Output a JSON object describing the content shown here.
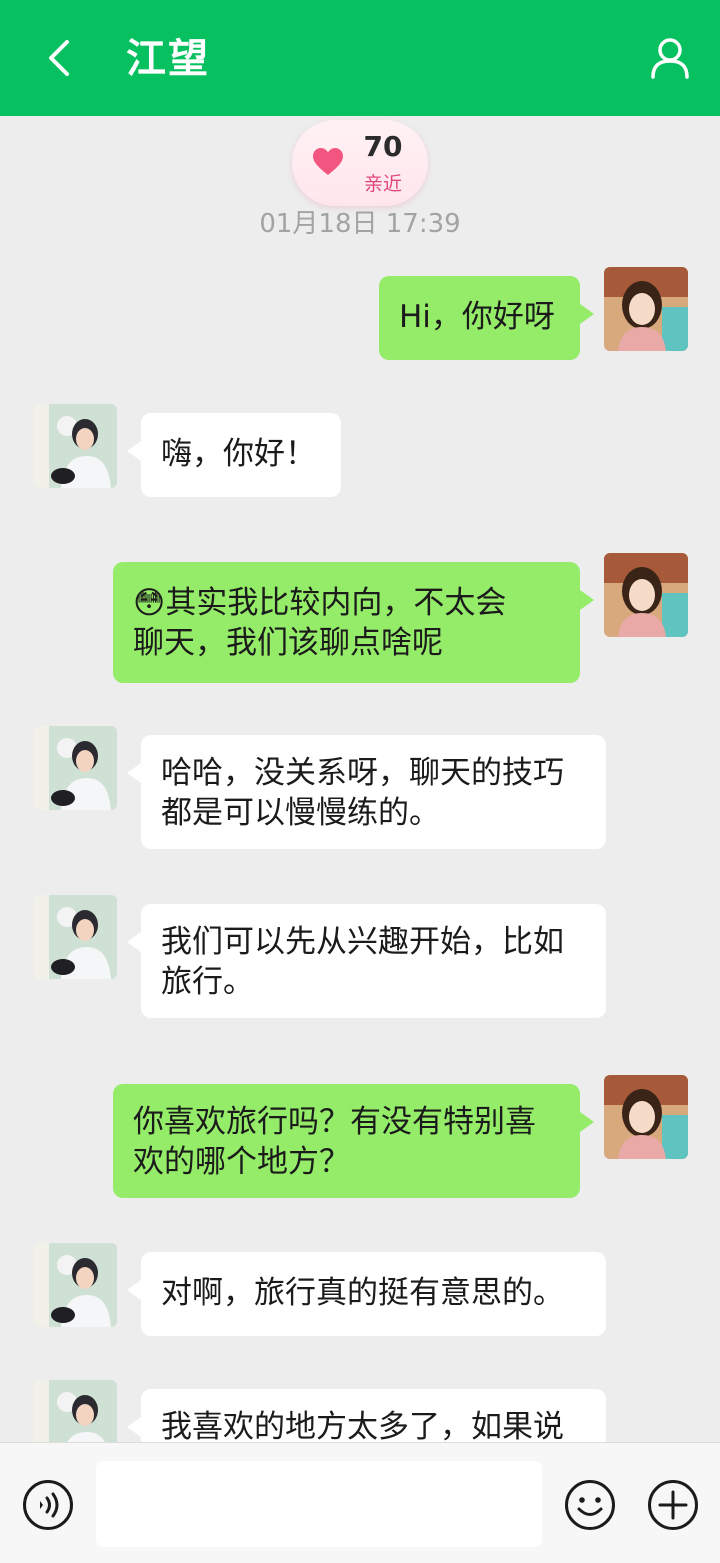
{
  "header": {
    "title": "江望",
    "colors": {
      "bar": "#07c160"
    }
  },
  "intimacy": {
    "score": "70",
    "label": "亲近"
  },
  "timestamp": "01月18日 17:39",
  "messages": [
    {
      "sender": "me",
      "lines": [
        "Hi，你好呀"
      ]
    },
    {
      "sender": "other",
      "lines": [
        "嗨，你好！"
      ]
    },
    {
      "sender": "me",
      "lines": [
        "😳其实我比较内向，不太会",
        "聊天，我们该聊点啥呢"
      ]
    },
    {
      "sender": "other",
      "lines": [
        "哈哈，没关系呀，聊天的技巧",
        "都是可以慢慢练的。"
      ]
    },
    {
      "sender": "other",
      "lines": [
        "我们可以先从兴趣开始，比如",
        "旅行。"
      ]
    },
    {
      "sender": "me",
      "lines": [
        "你喜欢旅行吗？有没有特别喜",
        "欢的哪个地方？"
      ]
    },
    {
      "sender": "other",
      "lines": [
        "对啊，旅行真的挺有意思的。"
      ]
    },
    {
      "sender": "other",
      "lines": [
        "我喜欢的地方太多了，如果说"
      ]
    }
  ],
  "input": {
    "value": "",
    "placeholder": ""
  },
  "icons": {
    "back": "chevron-left-icon",
    "profile": "person-icon",
    "voice": "voice-icon",
    "emoji": "smiley-icon",
    "more": "plus-icon",
    "heart": "heart-icon"
  },
  "colors": {
    "me_bubble": "#95ec69",
    "other_bubble": "#ffffff",
    "background": "#ededed",
    "intimacy_label": "#e0457b"
  }
}
